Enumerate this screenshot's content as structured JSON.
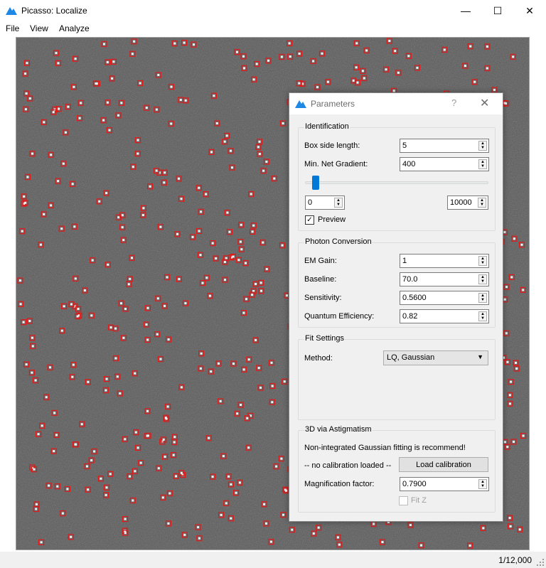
{
  "window": {
    "title": "Picasso: Localize",
    "controls": {
      "minimize": "—",
      "maximize": "☐",
      "close": "✕"
    }
  },
  "menu": {
    "items": [
      "File",
      "View",
      "Analyze"
    ]
  },
  "status": {
    "frame": "1/12,000"
  },
  "colors": {
    "marker": "#e01818",
    "accent": "#0078d7",
    "icon": "#1e88e5"
  },
  "dialog": {
    "title": "Parameters",
    "help": "?",
    "close": "✕",
    "identification": {
      "title": "Identification",
      "box_label": "Box side length:",
      "box_value": "5",
      "gradient_label": "Min. Net Gradient:",
      "gradient_value": "400",
      "range_min": "0",
      "range_max": "10000",
      "slider_position": 0.04,
      "preview_label": "Preview",
      "preview_checked": true
    },
    "photon": {
      "title": "Photon Conversion",
      "em_label": "EM Gain:",
      "em_value": "1",
      "baseline_label": "Baseline:",
      "baseline_value": "70.0",
      "sensitivity_label": "Sensitivity:",
      "sensitivity_value": "0.5600",
      "qe_label": "Quantum Efficiency:",
      "qe_value": "0.82"
    },
    "fit": {
      "title": "Fit Settings",
      "method_label": "Method:",
      "method_value": "LQ, Gaussian"
    },
    "astig": {
      "title": "3D via Astigmatism",
      "note": "Non-integrated Gaussian fitting is recommend!",
      "calib_status": "-- no calibration loaded --",
      "load_label": "Load calibration",
      "mag_label": "Magnification factor:",
      "mag_value": "0.7900",
      "fitz_label": "Fit Z",
      "fitz_checked": false
    }
  }
}
